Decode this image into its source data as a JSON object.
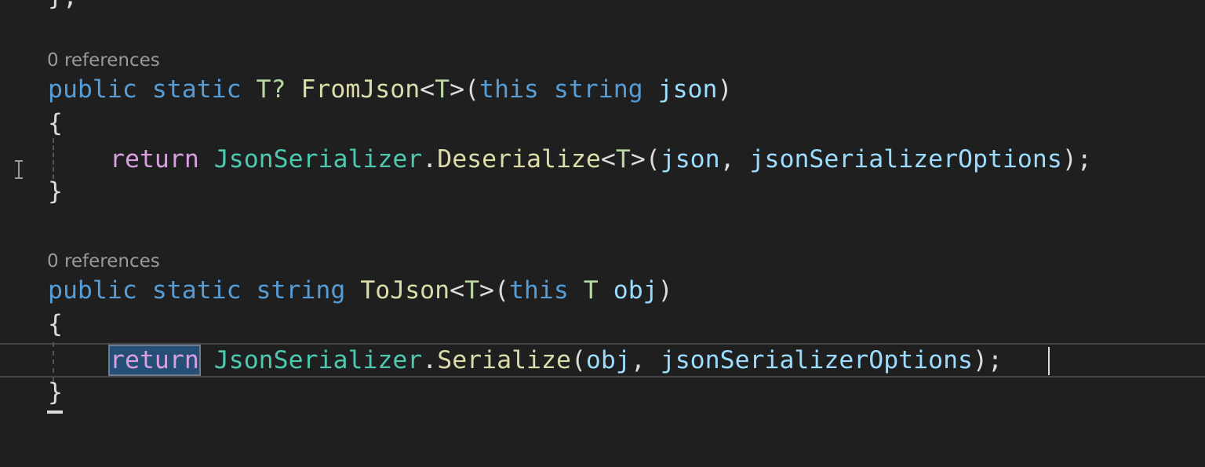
{
  "editor": {
    "top_fragment": "};",
    "method1": {
      "codelens": "0 references",
      "sig": {
        "kw_public": "public",
        "kw_static": "static",
        "ret_type": "T?",
        "name": "FromJson",
        "lt": "<",
        "type_param": "T",
        "gt_paren": ">(",
        "kw_this": "this",
        "kw_string": "string",
        "param": "json",
        "close": ")"
      },
      "open_brace": "{",
      "body": {
        "kw_return": "return",
        "class_name": "JsonSerializer",
        "dot": ".",
        "method": "Deserialize",
        "lt": "<",
        "type_arg": "T",
        "gt_paren": ">(",
        "arg1": "json",
        "comma": ", ",
        "arg2": "jsonSerializerOptions",
        "end": ");"
      },
      "close_brace": "}"
    },
    "method2": {
      "codelens": "0 references",
      "sig": {
        "kw_public": "public",
        "kw_static": "static",
        "kw_string": "string",
        "name": "ToJson",
        "lt": "<",
        "type_param": "T",
        "gt_paren": ">(",
        "kw_this": "this",
        "param_type": "T",
        "param": "obj",
        "close": ")"
      },
      "open_brace": "{",
      "body": {
        "kw_return": "return",
        "class_name": "JsonSerializer",
        "dot": ".",
        "method": "Serialize",
        "paren": "(",
        "arg1": "obj",
        "comma": ", ",
        "arg2": "jsonSerializerOptions",
        "end": ");"
      },
      "close_brace": "}"
    }
  }
}
